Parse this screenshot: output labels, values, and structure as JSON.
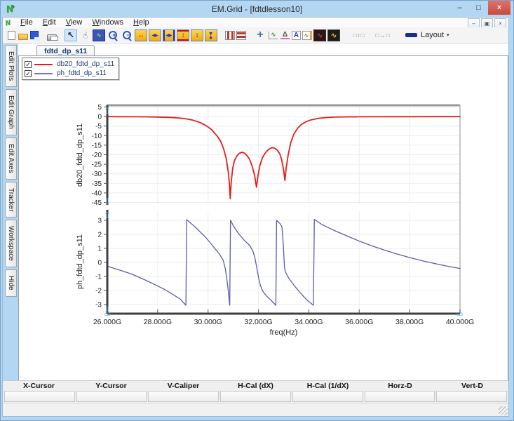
{
  "window": {
    "title": "EM.Grid - [fdtdlesson10]",
    "controls": {
      "minimize": "–",
      "maximize": "□",
      "close": "×"
    },
    "mdi_controls": {
      "minimize": "–",
      "restore": "▣",
      "close": "×"
    }
  },
  "colors": {
    "titlebar": "#b3d6f2",
    "close_button": "#c94a3e",
    "curve_db20": "#e81c1c",
    "curve_phase": "#5b5bb0",
    "toolbar_gold": "#f0ad0b"
  },
  "menu": {
    "items": [
      {
        "label": "File"
      },
      {
        "label": "Edit"
      },
      {
        "label": "View"
      },
      {
        "label": "Windows"
      },
      {
        "label": "Help"
      }
    ]
  },
  "toolbar": {
    "icons": [
      {
        "name": "new-document-icon",
        "cls": "page",
        "glyph": ""
      },
      {
        "name": "open-file-icon",
        "cls": "folder",
        "glyph": ""
      },
      {
        "name": "save-icon",
        "cls": "floppy",
        "glyph": ""
      },
      {
        "gap": true
      },
      {
        "name": "print-icon",
        "cls": "printer",
        "glyph": ""
      },
      {
        "gap": true
      },
      {
        "name": "select-cursor-icon",
        "cls": "sel cursor",
        "glyph": "↖"
      },
      {
        "name": "pan-hand-icon",
        "cls": "hand",
        "glyph": "☜",
        "wrap": true
      },
      {
        "name": "zoom-region-icon",
        "cls": "bluebox",
        "glyph": "∿"
      },
      {
        "name": "zoom-in-icon",
        "cls": "mag",
        "glyph": "+",
        "magb": true
      },
      {
        "name": "zoom-out-icon",
        "cls": "mag",
        "glyph": "−",
        "magb": true
      },
      {
        "name": "expand-x-icon",
        "cls": "gold redg",
        "glyph": "↔"
      },
      {
        "name": "shrink-x-icon",
        "cls": "gold blueg small",
        "glyph": "◀▶"
      },
      {
        "name": "fit-x-icon",
        "cls": "gold blueg small barsx",
        "glyph": "◀▶"
      },
      {
        "name": "fit-y-icon",
        "cls": "gold redg barsy",
        "glyph": "↕"
      },
      {
        "name": "expand-y-icon",
        "cls": "gold blueg",
        "glyph": "↕"
      },
      {
        "name": "compress-y-icon",
        "cls": "gold blueg small rot90",
        "glyph": "▶◀",
        "wrap": true
      },
      {
        "gap": true
      },
      {
        "name": "column-panes-icon",
        "cls": "panesv",
        "glyph": ""
      },
      {
        "name": "row-panes-icon",
        "cls": "panesh",
        "glyph": ""
      },
      {
        "gap": true
      },
      {
        "name": "crosshair-icon",
        "cls": "plus",
        "glyph": "+"
      },
      {
        "name": "axes-icon",
        "cls": "axes",
        "glyph": "∿"
      },
      {
        "name": "delta-marker-icon",
        "cls": "delta",
        "glyph": "Δ"
      },
      {
        "name": "text-label-icon",
        "cls": "abox",
        "glyph": "A"
      },
      {
        "name": "subplot-icon",
        "cls": "subplot",
        "glyph": "∿"
      },
      {
        "name": "trace-red-icon",
        "cls": "darkbox",
        "glyph": "∿"
      },
      {
        "name": "trace-yellow-icon",
        "cls": "darkbox yellowg",
        "glyph": "∿"
      },
      {
        "gap": true
      },
      {
        "name": "vertical-spacing-icon",
        "cls": "spacing",
        "glyph": "□↕□"
      },
      {
        "name": "horizontal-spacing-icon",
        "cls": "spacing",
        "glyph": "□↔□"
      },
      {
        "gap": true
      },
      {
        "name": "layout-button",
        "cls": "layoutbtn",
        "label": "Layout",
        "caret": "▾"
      }
    ]
  },
  "tabs": [
    {
      "label": "fdtd_dp_s11"
    }
  ],
  "sidebar": {
    "items": [
      {
        "label": "Edit Plots"
      },
      {
        "label": "Edit Graph"
      },
      {
        "label": "Edit Axes"
      },
      {
        "label": "Tracker"
      },
      {
        "label": "Workspace"
      },
      {
        "label": "Hide"
      }
    ]
  },
  "legend": {
    "items": [
      {
        "label": "db20_fdtd_dp_s11",
        "color": "#e81c1c",
        "checked": true,
        "check_glyph": "✓"
      },
      {
        "label": "ph_fdtd_dp_s11",
        "color": "#7b74c8",
        "checked": true,
        "check_glyph": "✓"
      }
    ]
  },
  "readout": {
    "columns": [
      "X-Cursor",
      "Y-Cursor",
      "V-Caliper",
      "H-Cal (dX)",
      "H-Cal (1/dX)",
      "Horz-D",
      "Vert-D"
    ],
    "values": [
      "",
      "",
      "",
      "",
      "",
      "",
      ""
    ]
  },
  "chart_data": [
    {
      "type": "line",
      "ylabel": "db20_fdtd_dp_s11",
      "ylim": [
        -45,
        5
      ],
      "yticks": [
        5,
        0,
        -5,
        -10,
        -15,
        -20,
        -25,
        -30,
        -35,
        -40,
        -45
      ],
      "xlim": [
        26,
        40
      ],
      "xticks": [
        26,
        28,
        30,
        32,
        34,
        36,
        38,
        40
      ],
      "grid": true,
      "series": [
        {
          "name": "db20_fdtd_dp_s11",
          "color": "#e81c1c",
          "x": [
            26,
            26.5,
            27,
            27.5,
            28,
            28.4,
            28.8,
            29.1,
            29.4,
            29.7,
            29.95,
            30.15,
            30.35,
            30.5,
            30.62,
            30.72,
            30.8,
            30.85,
            30.88,
            30.92,
            30.98,
            31.05,
            31.15,
            31.25,
            31.35,
            31.45,
            31.55,
            31.65,
            31.75,
            31.85,
            31.92,
            31.98,
            32.05,
            32.15,
            32.25,
            32.35,
            32.45,
            32.55,
            32.65,
            32.75,
            32.85,
            32.92,
            33.0,
            33.05,
            33.1,
            33.18,
            33.28,
            33.4,
            33.55,
            33.7,
            33.9,
            34.1,
            34.4,
            34.7,
            35,
            35.5,
            36,
            37,
            38,
            39,
            40
          ],
          "y": [
            -0.05,
            -0.08,
            -0.1,
            -0.15,
            -0.25,
            -0.4,
            -0.7,
            -1.1,
            -1.9,
            -3.2,
            -5,
            -7,
            -10,
            -13,
            -17,
            -22,
            -29,
            -36,
            -43,
            -34,
            -27,
            -23,
            -20.5,
            -19.2,
            -18.7,
            -19.2,
            -20.5,
            -22.5,
            -26,
            -31,
            -37,
            -31,
            -26,
            -21.8,
            -19.4,
            -17.9,
            -16.8,
            -16.3,
            -16.6,
            -17.6,
            -19.6,
            -22.5,
            -28,
            -33.5,
            -27,
            -20,
            -13.8,
            -9.3,
            -6.2,
            -4.2,
            -2.6,
            -1.7,
            -0.9,
            -0.5,
            -0.3,
            -0.18,
            -0.12,
            -0.08,
            -0.06,
            -0.05,
            -0.05
          ]
        }
      ]
    },
    {
      "type": "line",
      "ylabel": "ph_fdtd_dp_s11",
      "xlabel": "freq(Hz)",
      "ylim": [
        -3,
        3
      ],
      "yticks": [
        3,
        2,
        1,
        0,
        -1,
        -2,
        -3
      ],
      "xlim": [
        26,
        40
      ],
      "xticks": [
        26,
        28,
        30,
        32,
        34,
        36,
        38,
        40
      ],
      "xtick_labels": [
        "26.000G",
        "28.000G",
        "30.000G",
        "32.000G",
        "34.000G",
        "36.000G",
        "38.000G",
        "40.000G"
      ],
      "grid": true,
      "series": [
        {
          "name": "ph_fdtd_dp_s11",
          "color": "#5b5bb0",
          "x": [
            26,
            26.5,
            27,
            27.5,
            28,
            28.3,
            28.6,
            28.9,
            29.12,
            29.15,
            29.5,
            29.9,
            30.2,
            30.45,
            30.6,
            30.68,
            30.74,
            30.8,
            30.86,
            30.89,
            31.0,
            31.2,
            31.45,
            31.65,
            31.78,
            31.86,
            31.93,
            32.0,
            32.08,
            32.18,
            32.35,
            32.55,
            32.69,
            32.72,
            32.85,
            32.93,
            32.99,
            33.03,
            33.07,
            33.2,
            33.45,
            33.7,
            33.95,
            34.18,
            34.22,
            34.5,
            35,
            35.5,
            36,
            36.5,
            37,
            37.5,
            38,
            38.5,
            39,
            39.5,
            40
          ],
          "y": [
            -0.27,
            -0.55,
            -0.85,
            -1.25,
            -1.68,
            -1.95,
            -2.28,
            -2.62,
            -3.05,
            3.05,
            2.5,
            1.8,
            1.15,
            0.6,
            0.15,
            -0.4,
            -1.1,
            -2.0,
            -3.05,
            3.02,
            2.62,
            2.08,
            1.55,
            1.22,
            0.8,
            0.32,
            -0.35,
            -1.05,
            -1.65,
            -2.08,
            -2.45,
            -2.78,
            -3.05,
            3.0,
            2.78,
            2.55,
            1.2,
            -0.3,
            -0.68,
            -1.12,
            -1.72,
            -2.25,
            -2.72,
            -3.05,
            3.07,
            2.72,
            2.28,
            1.9,
            1.52,
            1.18,
            0.88,
            0.6,
            0.35,
            0.12,
            -0.08,
            -0.27,
            -0.43
          ]
        }
      ]
    }
  ]
}
